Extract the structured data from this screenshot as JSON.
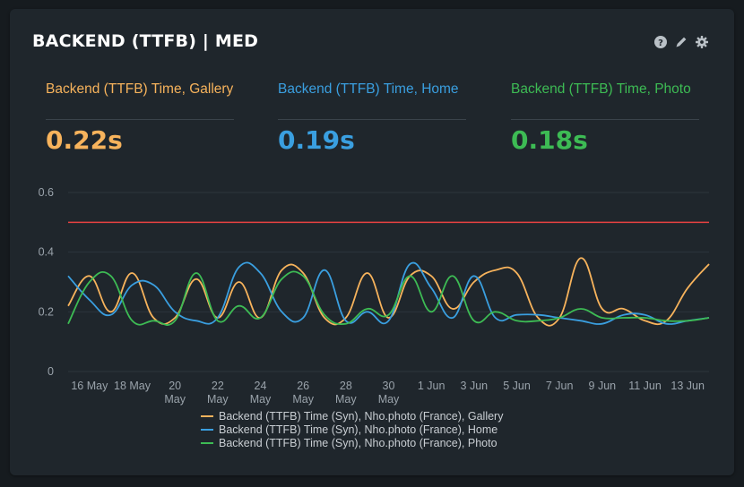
{
  "panel": {
    "title": "BACKEND (TTFB) | MED"
  },
  "tools": [
    {
      "icon": "help-icon"
    },
    {
      "icon": "pencil-icon"
    },
    {
      "icon": "gear-icon"
    }
  ],
  "metrics": [
    {
      "label": "Backend (TTFB) Time, Gallery",
      "value": "0.22s",
      "color": "#f7b35c"
    },
    {
      "label": "Backend (TTFB) Time, Home",
      "value": "0.19s",
      "color": "#3a9fe0"
    },
    {
      "label": "Backend (TTFB) Time, Photo",
      "value": "0.18s",
      "color": "#3dbb54"
    }
  ],
  "chart_data": {
    "type": "line",
    "title": "",
    "xlabel": "",
    "ylabel": "",
    "ylim": [
      0,
      0.6
    ],
    "yticks": [
      "0",
      "0.2",
      "0.4",
      "0.6"
    ],
    "xticks": [
      "16 May",
      "18 May",
      "20 May",
      "22 May",
      "24 May",
      "26 May",
      "28 May",
      "30 May",
      "1 Jun",
      "3 Jun",
      "5 Jun",
      "7 Jun",
      "9 Jun",
      "11 Jun",
      "13 Jun"
    ],
    "grid": "horizontal",
    "legend_position": "bottom",
    "threshold": {
      "value": 0.5,
      "color": "#e64141"
    },
    "x": [
      "15 May",
      "16 May",
      "17 May",
      "18 May",
      "19 May",
      "20 May",
      "21 May",
      "22 May",
      "23 May",
      "24 May",
      "25 May",
      "26 May",
      "27 May",
      "28 May",
      "29 May",
      "30 May",
      "31 May",
      "1 Jun",
      "2 Jun",
      "3 Jun",
      "4 Jun",
      "5 Jun",
      "6 Jun",
      "7 Jun",
      "8 Jun",
      "9 Jun",
      "10 Jun",
      "11 Jun",
      "12 Jun",
      "13 Jun",
      "14 Jun"
    ],
    "series": [
      {
        "name": "Backend (TTFB) Time (Syn), Nho.photo (France), Gallery",
        "color": "#f7b35c",
        "values": [
          0.22,
          0.32,
          0.2,
          0.33,
          0.18,
          0.18,
          0.31,
          0.18,
          0.3,
          0.18,
          0.34,
          0.33,
          0.18,
          0.18,
          0.33,
          0.18,
          0.32,
          0.32,
          0.21,
          0.3,
          0.34,
          0.33,
          0.18,
          0.18,
          0.38,
          0.21,
          0.21,
          0.17,
          0.17,
          0.28,
          0.36
        ]
      },
      {
        "name": "Backend (TTFB) Time (Syn), Nho.photo (France), Home",
        "color": "#3a9fe0",
        "values": [
          0.32,
          0.24,
          0.19,
          0.29,
          0.29,
          0.2,
          0.17,
          0.18,
          0.35,
          0.33,
          0.2,
          0.18,
          0.34,
          0.17,
          0.2,
          0.17,
          0.36,
          0.28,
          0.18,
          0.32,
          0.18,
          0.19,
          0.19,
          0.18,
          0.17,
          0.16,
          0.19,
          0.19,
          0.16,
          0.17,
          0.18
        ]
      },
      {
        "name": "Backend (TTFB) Time (Syn), Nho.photo (France), Photo",
        "color": "#3dbb54",
        "values": [
          0.16,
          0.3,
          0.32,
          0.17,
          0.17,
          0.17,
          0.33,
          0.17,
          0.22,
          0.18,
          0.31,
          0.32,
          0.19,
          0.16,
          0.21,
          0.19,
          0.32,
          0.2,
          0.32,
          0.17,
          0.2,
          0.17,
          0.17,
          0.18,
          0.21,
          0.18,
          0.18,
          0.18,
          0.17,
          0.17,
          0.18
        ]
      }
    ]
  }
}
